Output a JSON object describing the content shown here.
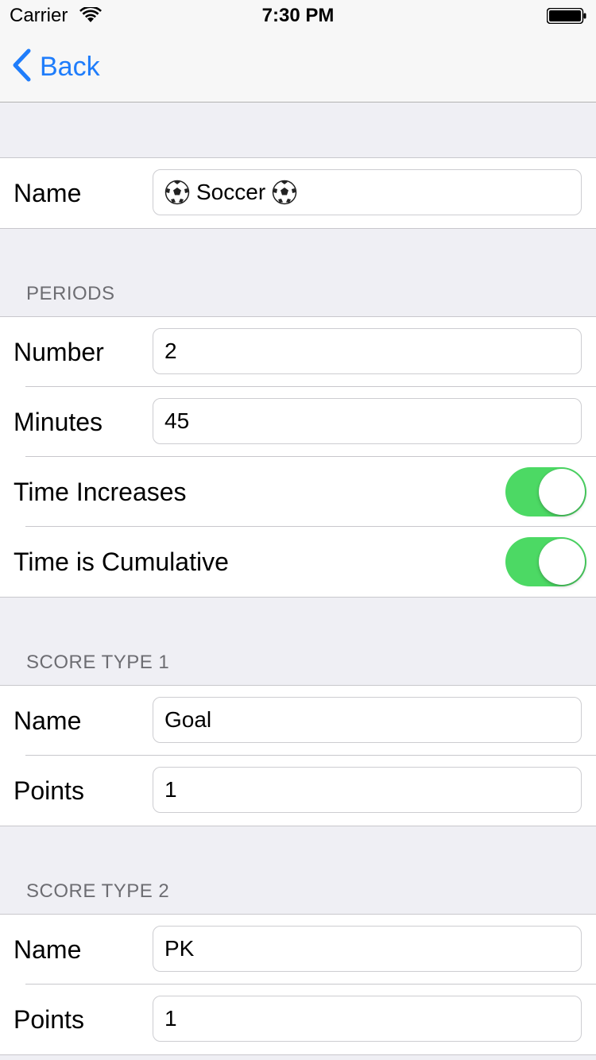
{
  "status": {
    "carrier": "Carrier",
    "time": "7:30 PM"
  },
  "nav": {
    "back_label": "Back"
  },
  "name_row": {
    "label": "Name",
    "value": "Soccer",
    "icon": "soccer-ball-icon"
  },
  "periods": {
    "header": "PERIODS",
    "number_label": "Number",
    "number_value": "2",
    "minutes_label": "Minutes",
    "minutes_value": "45",
    "time_increases_label": "Time Increases",
    "time_increases_on": true,
    "time_cumulative_label": "Time is Cumulative",
    "time_cumulative_on": true
  },
  "score_type_1": {
    "header": "SCORE TYPE 1",
    "name_label": "Name",
    "name_value": "Goal",
    "points_label": "Points",
    "points_value": "1"
  },
  "score_type_2": {
    "header": "SCORE TYPE 2",
    "name_label": "Name",
    "name_value": "PK",
    "points_label": "Points",
    "points_value": "1"
  },
  "colors": {
    "accent": "#1f7dfb",
    "toggle_on": "#4cd964",
    "background": "#efeff4"
  }
}
